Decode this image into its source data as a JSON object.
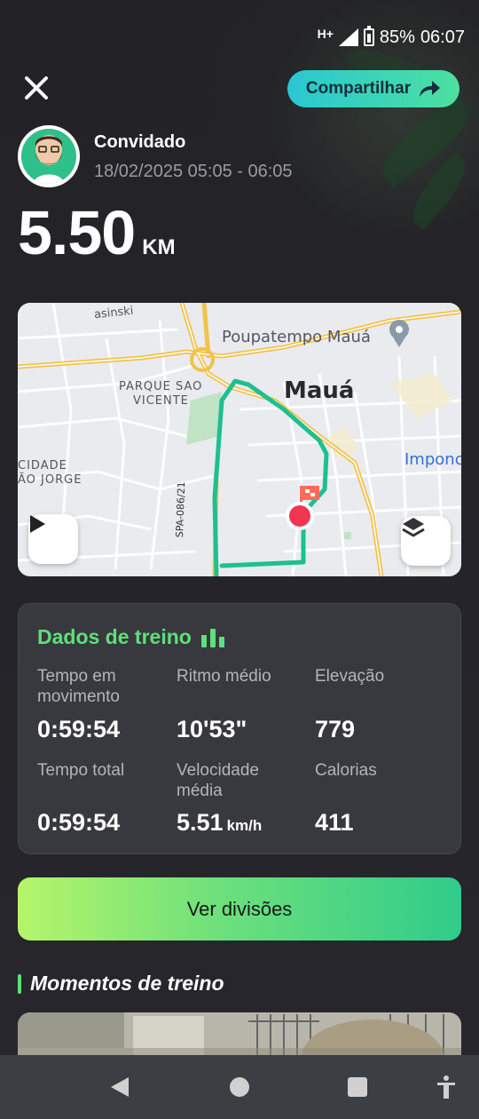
{
  "status_bar": {
    "network": "H+",
    "battery": "85%",
    "time": "06:07"
  },
  "header": {
    "share_label": "Compartilhar"
  },
  "user": {
    "name": "Convidado",
    "date_range": "18/02/2025 05:05 - 06:05"
  },
  "distance": {
    "value": "5.50",
    "unit": "KM"
  },
  "map": {
    "labels": {
      "street": "asinski",
      "poi": "Poupatempo Mauá",
      "city": "Mauá",
      "district1_line1": "PARQUE SAO",
      "district1_line2": "VICENTE",
      "district2_line1": "CIDADE",
      "district2_line2": "ÃO JORGE",
      "road": "SPA-086/21",
      "place": "Imponc"
    }
  },
  "stats": {
    "title": "Dados de treino",
    "items": [
      {
        "label": "Tempo em movimento",
        "value": "0:59:54",
        "unit": ""
      },
      {
        "label": "Ritmo médio",
        "value": "10'53\"",
        "unit": ""
      },
      {
        "label": "Elevação",
        "value": "779",
        "unit": ""
      },
      {
        "label": "Tempo total",
        "value": "0:59:54",
        "unit": ""
      },
      {
        "label": "Velocidade média",
        "value": "5.51",
        "unit": "km/h"
      },
      {
        "label": "Calorias",
        "value": "411",
        "unit": ""
      }
    ]
  },
  "splits_button": "Ver divisões",
  "moments": {
    "title": "Momentos de treino"
  },
  "colors": {
    "accent_green": "#5ee07a",
    "route": "#1fbf8f",
    "card_bg": "#38383f"
  },
  "nav": {
    "icons": [
      "back-icon",
      "home-icon",
      "recents-icon",
      "accessibility-icon"
    ]
  }
}
